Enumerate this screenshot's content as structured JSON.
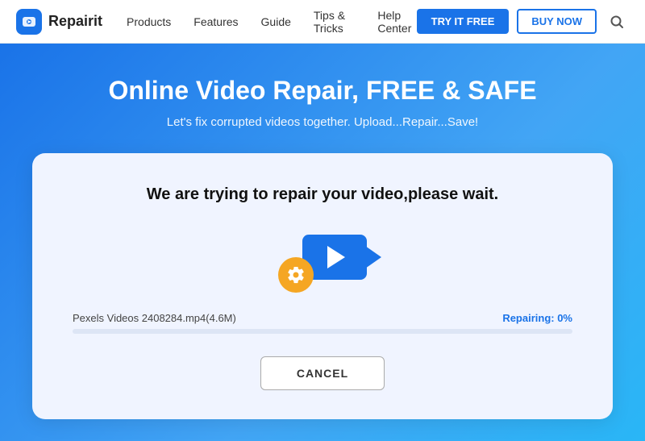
{
  "header": {
    "logo_text": "Repairit",
    "nav_items": [
      {
        "label": "Products",
        "id": "products"
      },
      {
        "label": "Features",
        "id": "features"
      },
      {
        "label": "Guide",
        "id": "guide"
      },
      {
        "label": "Tips & Tricks",
        "id": "tips-tricks"
      },
      {
        "label": "Help Center",
        "id": "help-center"
      }
    ],
    "btn_try_label": "TRY IT FREE",
    "btn_buy_label": "BUY NOW"
  },
  "hero": {
    "title": "Online Video Repair, FREE & SAFE",
    "subtitle": "Let's fix corrupted videos together. Upload...Repair...Save!"
  },
  "card": {
    "title": "We are trying to repair your video,please wait.",
    "file_label": "Pexels Videos 2408284.mp4(4.6M)",
    "repair_status": "Repairing: 0%",
    "progress_value": 0,
    "cancel_label": "CANCEL"
  },
  "icons": {
    "gear": "⚙",
    "search": "🔍"
  }
}
